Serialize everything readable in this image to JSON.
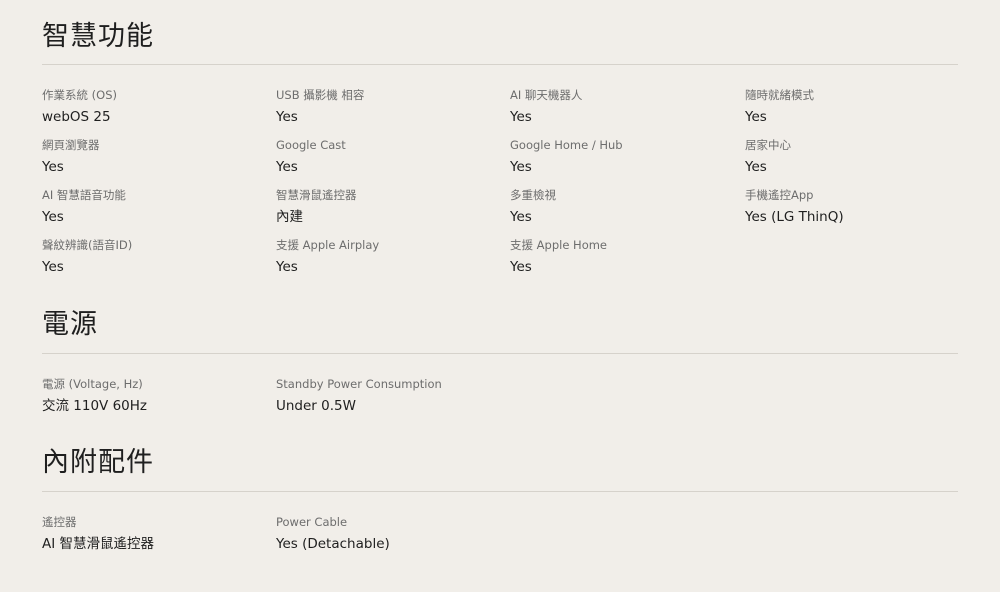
{
  "smart": {
    "title": "智慧功能",
    "specs": [
      {
        "label": "作業系統 (OS)",
        "value": "webOS 25"
      },
      {
        "label": "USB 攝影機 相容",
        "value": "Yes"
      },
      {
        "label": "AI 聊天機器人",
        "value": "Yes"
      },
      {
        "label": "隨時就緒模式",
        "value": "Yes"
      },
      {
        "label": "網頁瀏覽器",
        "value": "Yes"
      },
      {
        "label": "Google Cast",
        "value": "Yes"
      },
      {
        "label": "Google Home / Hub",
        "value": "Yes"
      },
      {
        "label": "居家中心",
        "value": "Yes"
      },
      {
        "label": "AI 智慧語音功能",
        "value": "Yes"
      },
      {
        "label": "智慧滑鼠遙控器",
        "value": "內建"
      },
      {
        "label": "多重檢視",
        "value": "Yes"
      },
      {
        "label": "手機遙控App",
        "value": "Yes (LG ThinQ)"
      },
      {
        "label": "聲紋辨識(語音ID)",
        "value": "Yes"
      },
      {
        "label": "支援 Apple Airplay",
        "value": "Yes"
      },
      {
        "label": "支援 Apple Home",
        "value": "Yes"
      }
    ]
  },
  "power": {
    "title": "電源",
    "specs": [
      {
        "label": "電源 (Voltage, Hz)",
        "value": "交流 110V 60Hz"
      },
      {
        "label": "Standby Power Consumption",
        "value": "Under 0.5W"
      }
    ]
  },
  "accessories": {
    "title": "內附配件",
    "specs": [
      {
        "label": "遙控器",
        "value": "AI 智慧滑鼠遙控器"
      },
      {
        "label": "Power Cable",
        "value": "Yes (Detachable)"
      }
    ]
  }
}
